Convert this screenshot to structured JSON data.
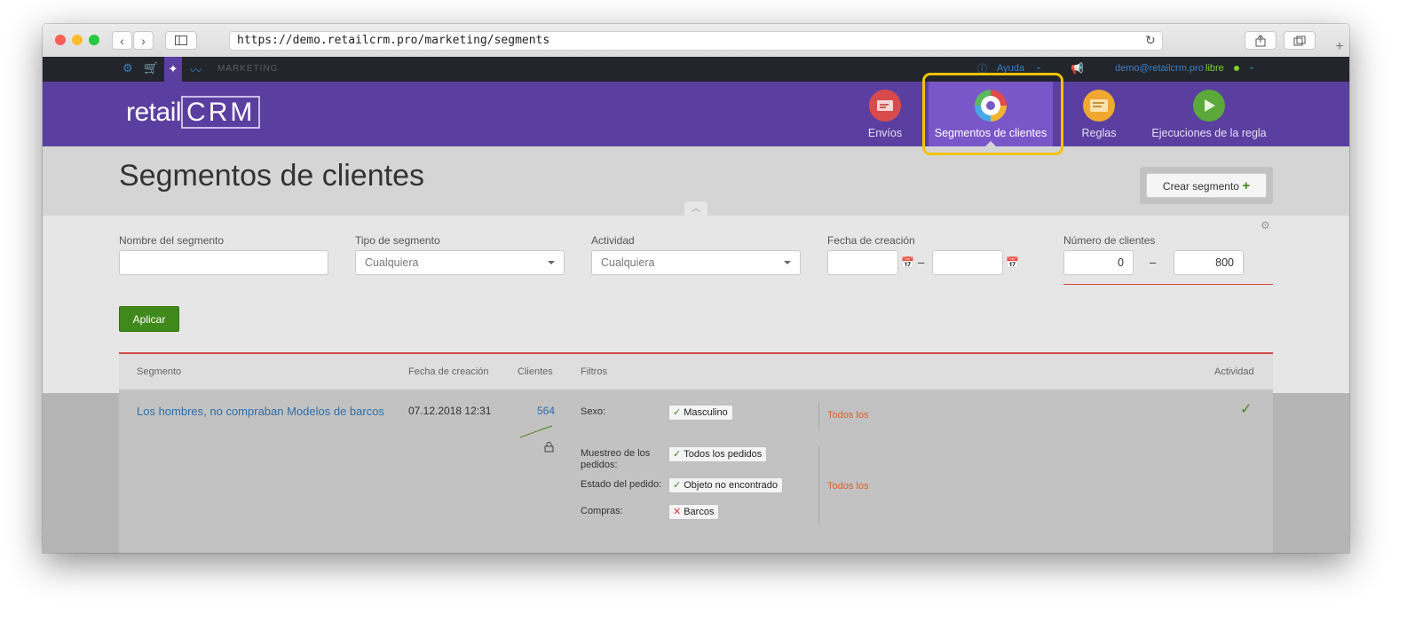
{
  "browser": {
    "url": "https://demo.retailcrm.pro/marketing/segments"
  },
  "topbar": {
    "section": "MARKETING",
    "help": "Ayuda",
    "user_email": "demo@retailcrm.pro",
    "user_status": "libre"
  },
  "header": {
    "logo_text": "retail",
    "logo_box": "CRM",
    "nav": [
      {
        "label": "Envíos",
        "icon": "mail-icon",
        "color": "#d94a4a"
      },
      {
        "label": "Segmentos de clientes",
        "icon": "segments-icon",
        "color": "#7a57c9"
      },
      {
        "label": "Reglas",
        "icon": "rules-icon",
        "color": "#f0a830"
      },
      {
        "label": "Ejecuciones de la regla",
        "icon": "play-icon",
        "color": "#5aa93a"
      }
    ]
  },
  "page": {
    "title": "Segmentos de clientes",
    "create_button": "Crear segmento",
    "create_plus": "+"
  },
  "filters": {
    "segment_name_label": "Nombre del segmento",
    "segment_name_value": "",
    "segment_type_label": "Tipo de segmento",
    "segment_type_value": "Cualquiera",
    "activity_label": "Actividad",
    "activity_value": "Cualquiera",
    "date_label": "Fecha de creación",
    "date_from": "",
    "date_to": "",
    "date_sep": "–",
    "clients_label": "Número de clientes",
    "clients_min": "0",
    "clients_max": "800",
    "clients_sep": "–",
    "apply": "Aplicar"
  },
  "table": {
    "headers": [
      "Segmento",
      "Fecha de creación",
      "Clientes",
      "Filtros",
      "Actividad"
    ],
    "row": {
      "segment": "Los hombres, no compraban Modelos de barcos",
      "date": "07.12.2018 12:31",
      "clients": "564",
      "active_mark": "✓",
      "filters": [
        {
          "label": "Sexo:",
          "tag": "Masculino",
          "state": "ok",
          "scope": "Todos los"
        },
        {
          "label": "Muestreo de los pedidos:",
          "tag": "Todos los pedidos",
          "state": "ok",
          "scope": ""
        },
        {
          "label": "Estado del pedido:",
          "tag": "Objeto no encontrado",
          "state": "ok",
          "scope": "Todos los"
        },
        {
          "label": "Compras:",
          "tag": "Barcos",
          "state": "no",
          "scope": ""
        }
      ]
    }
  },
  "colors": {
    "header_purple": "#5b3fa0",
    "apply_green": "#3f8a1a",
    "highlight": "#f3c300"
  }
}
